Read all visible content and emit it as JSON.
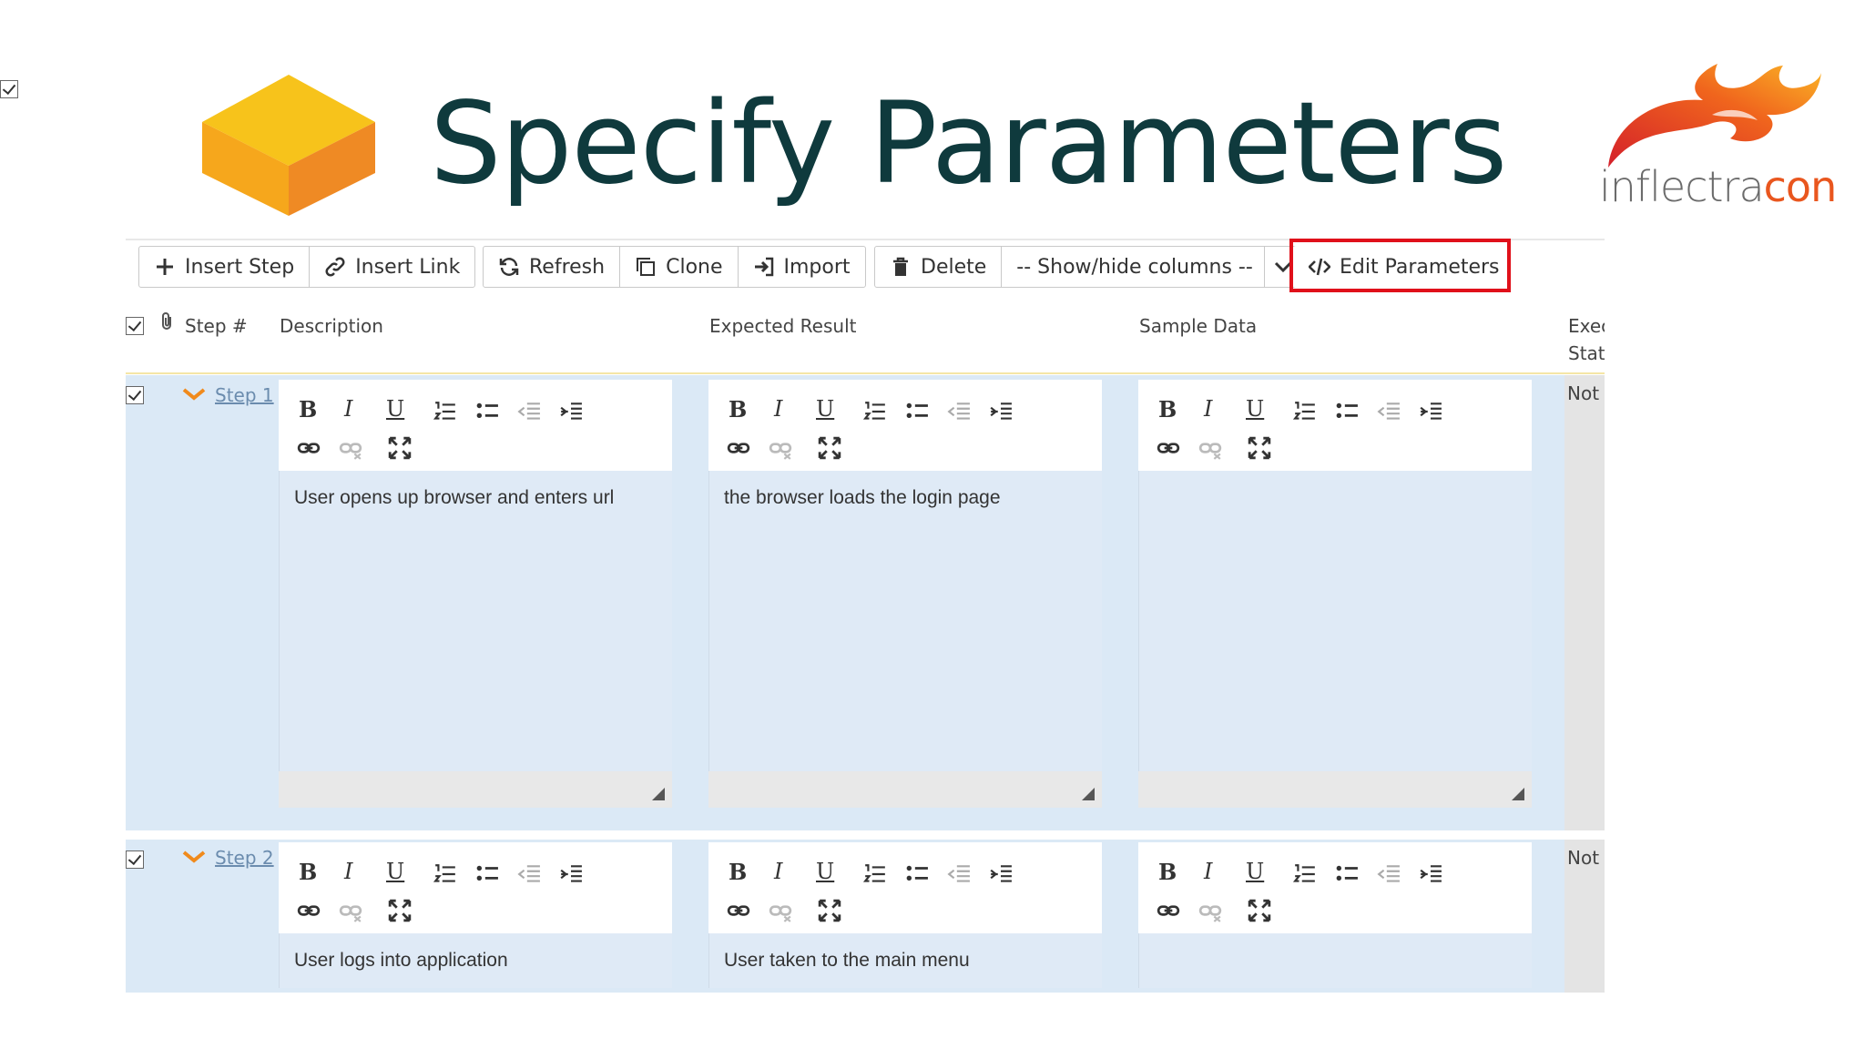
{
  "title": "Specify Parameters",
  "logo": {
    "part1": "inflectra",
    "part2": "con"
  },
  "colors": {
    "title": "#0f3a3d",
    "highlight": "#e0101a",
    "row_bg": "#dbe9f6",
    "step_link": "#6b8cae",
    "logo_orange": "#e9561e"
  },
  "toolbar": {
    "insert_step": "Insert Step",
    "insert_link": "Insert Link",
    "refresh": "Refresh",
    "clone": "Clone",
    "import": "Import",
    "delete": "Delete",
    "show_hide": "-- Show/hide columns --",
    "edit_parameters": "Edit Parameters"
  },
  "columns": {
    "step": "Step #",
    "description": "Description",
    "expected": "Expected Result",
    "sample": "Sample Data",
    "exec_line1": "Exec",
    "exec_line2": "Stat"
  },
  "rows": [
    {
      "step": "Step 1",
      "description": "User opens up browser and enters url",
      "expected": "the browser loads the login page",
      "sample": "",
      "status": "Not"
    },
    {
      "step": "Step 2",
      "description": "User logs into application",
      "expected": "User taken to the main menu",
      "sample": "",
      "status": "Not"
    }
  ],
  "editor_icons": [
    "bold-icon",
    "italic-icon",
    "underline-icon",
    "ordered-list-icon",
    "bullet-list-icon",
    "outdent-icon",
    "indent-icon",
    "link-icon",
    "unlink-icon",
    "fullscreen-icon"
  ],
  "editor_glyphs": {
    "bold": "B",
    "italic": "I",
    "underline": "U"
  }
}
